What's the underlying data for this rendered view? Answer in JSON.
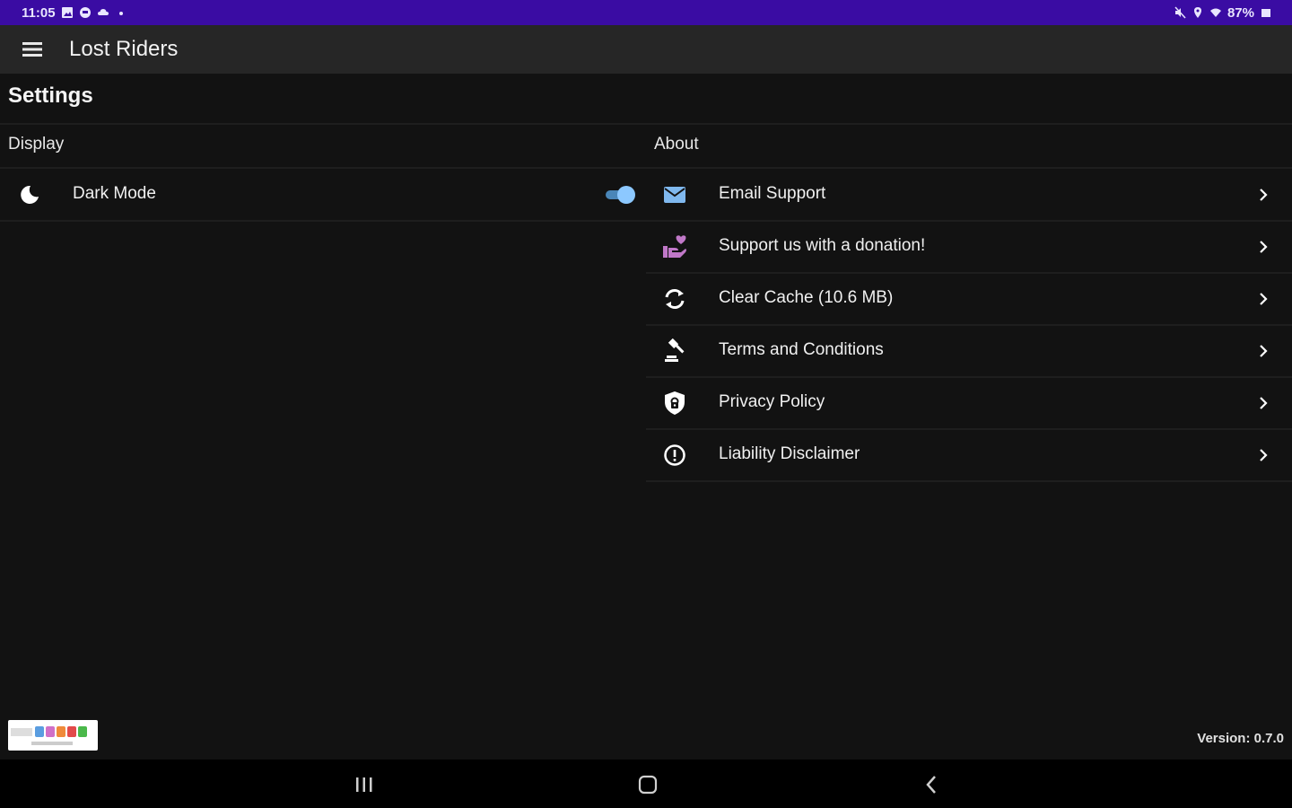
{
  "status_bar": {
    "time": "11:05",
    "battery": "87%"
  },
  "appbar": {
    "title": "Lost Riders",
    "menu_icon": "hamburger-menu-icon"
  },
  "page": {
    "title": "Settings"
  },
  "display_section": {
    "header": "Display",
    "items": [
      {
        "label": "Dark Mode",
        "icon": "moon-icon",
        "toggle_on": true
      }
    ]
  },
  "about_section": {
    "header": "About",
    "items": [
      {
        "label": "Email Support",
        "icon": "envelope-icon",
        "icon_color": "#7fb8ee"
      },
      {
        "label": "Support us with a donation!",
        "icon": "donation-hand-icon",
        "icon_color": "#c078c8"
      },
      {
        "label": "Clear Cache (10.6 MB)",
        "icon": "refresh-icon",
        "icon_color": "#ffffff"
      },
      {
        "label": "Terms and Conditions",
        "icon": "gavel-icon",
        "icon_color": "#ffffff"
      },
      {
        "label": "Privacy Policy",
        "icon": "shield-lock-icon",
        "icon_color": "#ffffff"
      },
      {
        "label": "Liability Disclaimer",
        "icon": "alert-circle-icon",
        "icon_color": "#ffffff"
      }
    ]
  },
  "footer": {
    "version": "Version: 0.7.0",
    "badge_icon": "collection-badge-logo"
  },
  "nav_bar": {
    "recents_icon": "recents-icon",
    "home_icon": "home-icon",
    "back_icon": "back-icon"
  },
  "colors": {
    "status_bar": "#3a0ca3",
    "appbar": "#262626",
    "background": "#121212",
    "toggle_accent": "#8cc8ff"
  }
}
